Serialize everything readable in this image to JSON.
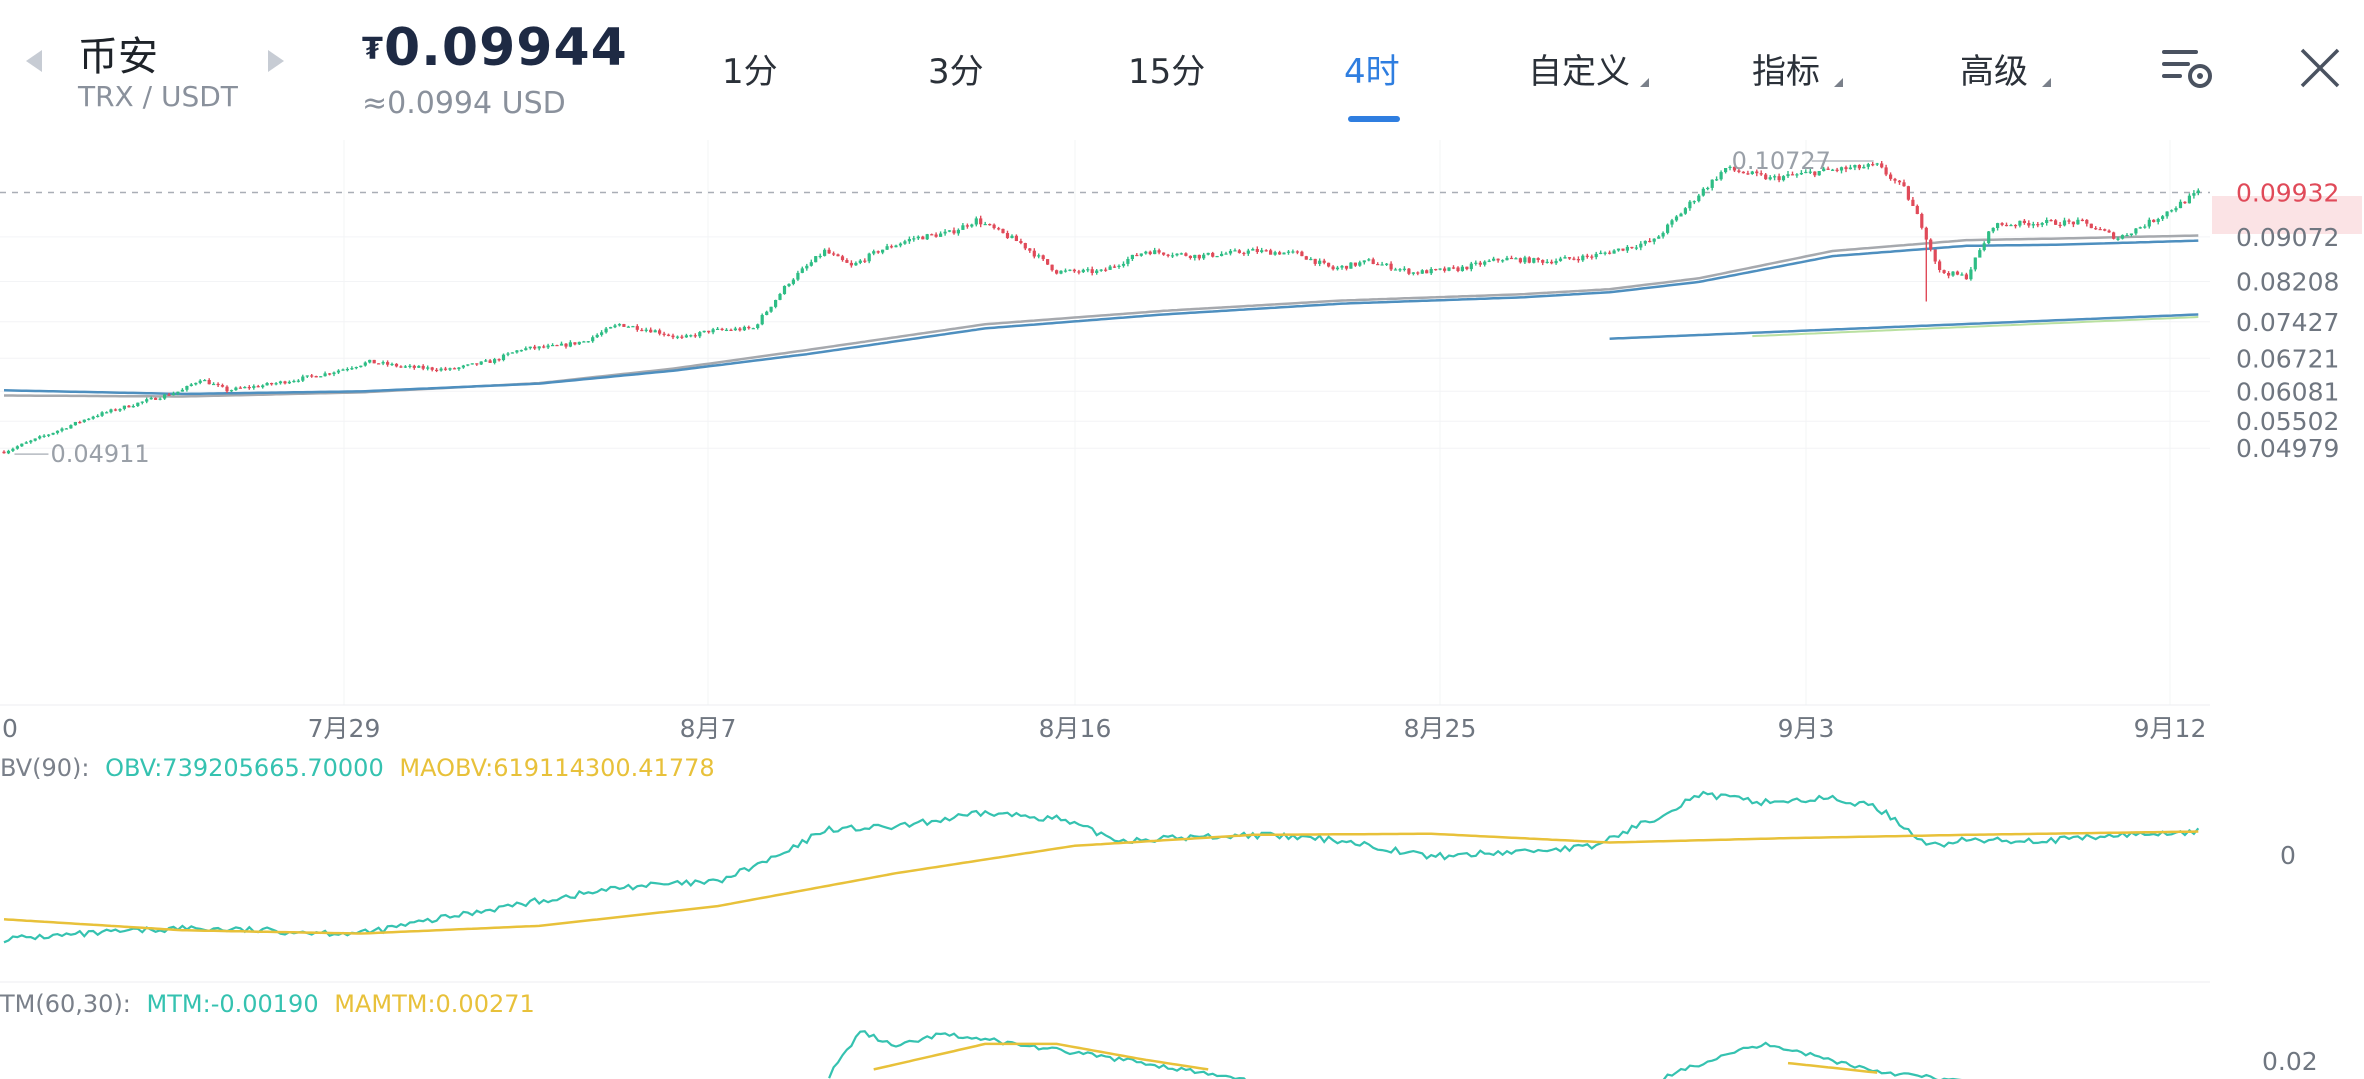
{
  "header": {
    "exchange": "币安",
    "pair": "TRX / USDT",
    "price_symbol": "₮",
    "price": "0.09944",
    "price_usd": "≈0.0994 USD",
    "tabs": [
      {
        "label": "1分",
        "active": false
      },
      {
        "label": "3分",
        "active": false
      },
      {
        "label": "15分",
        "active": false
      },
      {
        "label": "4时",
        "active": true
      },
      {
        "label": "自定义",
        "active": false,
        "dropdown": true
      },
      {
        "label": "指标",
        "active": false,
        "dropdown": true
      },
      {
        "label": "高级",
        "active": false,
        "dropdown": true
      }
    ],
    "icons": [
      "chart-settings-icon",
      "close-icon"
    ],
    "colors": {
      "accent": "#2f7ee0",
      "up": "#2ebd85",
      "down": "#e04a59"
    }
  },
  "chart_data": [
    {
      "type": "candlestick",
      "title": "TRX / USDT 4时",
      "x_tick_labels": [
        "0",
        "7月29",
        "8月7",
        "8月16",
        "8月25",
        "9月3",
        "9月12"
      ],
      "y_tick_labels": [
        "0.09932",
        "0.09072",
        "0.08208",
        "0.07427",
        "0.06721",
        "0.06081",
        "0.05502",
        "0.04979"
      ],
      "current_price": 0.09932,
      "max_label": "0.10727",
      "min_label": "0.04911",
      "ylim": [
        0.0475,
        0.1095
      ],
      "anchors_close": [
        [
          0,
          0.0491
        ],
        [
          10,
          0.0525
        ],
        [
          20,
          0.056
        ],
        [
          32,
          0.059
        ],
        [
          40,
          0.061
        ],
        [
          44,
          0.0632
        ],
        [
          50,
          0.061
        ],
        [
          60,
          0.0622
        ],
        [
          72,
          0.0642
        ],
        [
          82,
          0.0665
        ],
        [
          90,
          0.0655
        ],
        [
          100,
          0.065
        ],
        [
          110,
          0.0668
        ],
        [
          116,
          0.069
        ],
        [
          124,
          0.0695
        ],
        [
          130,
          0.0705
        ],
        [
          138,
          0.0738
        ],
        [
          146,
          0.0725
        ],
        [
          152,
          0.071
        ],
        [
          158,
          0.0725
        ],
        [
          168,
          0.073
        ],
        [
          176,
          0.082
        ],
        [
          184,
          0.088
        ],
        [
          190,
          0.085
        ],
        [
          196,
          0.088
        ],
        [
          204,
          0.0905
        ],
        [
          212,
          0.0915
        ],
        [
          218,
          0.094
        ],
        [
          228,
          0.0895
        ],
        [
          236,
          0.084
        ],
        [
          246,
          0.084
        ],
        [
          256,
          0.088
        ],
        [
          268,
          0.087
        ],
        [
          280,
          0.088
        ],
        [
          290,
          0.0875
        ],
        [
          298,
          0.0845
        ],
        [
          306,
          0.086
        ],
        [
          316,
          0.0838
        ],
        [
          326,
          0.0845
        ],
        [
          336,
          0.0865
        ],
        [
          346,
          0.086
        ],
        [
          356,
          0.087
        ],
        [
          370,
          0.09
        ],
        [
          380,
          0.099
        ],
        [
          386,
          0.104
        ],
        [
          396,
          0.102
        ],
        [
          408,
          0.1035
        ],
        [
          420,
          0.1045
        ],
        [
          426,
          0.1
        ],
        [
          430,
          0.093
        ],
        [
          434,
          0.084
        ],
        [
          440,
          0.083
        ],
        [
          446,
          0.093
        ],
        [
          456,
          0.0935
        ],
        [
          466,
          0.0935
        ],
        [
          474,
          0.0905
        ],
        [
          482,
          0.094
        ],
        [
          492,
          0.0993
        ]
      ],
      "spikes": [
        {
          "index": 431,
          "low": 0.0782
        }
      ],
      "ma_anchors": [
        [
          0,
          0.061
        ],
        [
          40,
          0.0603
        ],
        [
          80,
          0.0608
        ],
        [
          120,
          0.0623
        ],
        [
          150,
          0.0648
        ],
        [
          180,
          0.068
        ],
        [
          220,
          0.073
        ],
        [
          260,
          0.0757
        ],
        [
          300,
          0.0778
        ],
        [
          340,
          0.079
        ],
        [
          360,
          0.08
        ],
        [
          380,
          0.082
        ],
        [
          410,
          0.087
        ],
        [
          440,
          0.089
        ],
        [
          460,
          0.0892
        ],
        [
          492,
          0.09
        ]
      ],
      "ma2_anchors": [
        [
          0,
          0.06
        ],
        [
          40,
          0.0598
        ],
        [
          80,
          0.0606
        ],
        [
          120,
          0.0624
        ],
        [
          150,
          0.0652
        ],
        [
          180,
          0.0688
        ],
        [
          220,
          0.0738
        ],
        [
          260,
          0.0764
        ],
        [
          300,
          0.0784
        ],
        [
          340,
          0.0796
        ],
        [
          360,
          0.0806
        ],
        [
          380,
          0.0827
        ],
        [
          410,
          0.088
        ],
        [
          440,
          0.0901
        ],
        [
          460,
          0.0904
        ],
        [
          492,
          0.091
        ]
      ],
      "ma3_anchors": [
        [
          360,
          0.071
        ],
        [
          492,
          0.0757
        ]
      ],
      "ma4_anchors": [
        [
          392,
          0.0715
        ],
        [
          492,
          0.0752
        ]
      ]
    },
    {
      "type": "line",
      "label_prefix": "BV(90):",
      "obv_label": "OBV:739205665.70000",
      "maobv_label": "MAOBV:619114300.41778",
      "zero_label": "0",
      "obv_anchors": [
        [
          0,
          -0.9
        ],
        [
          40,
          -0.8
        ],
        [
          80,
          -0.85
        ],
        [
          110,
          -0.62
        ],
        [
          140,
          -0.42
        ],
        [
          160,
          -0.38
        ],
        [
          176,
          -0.1
        ],
        [
          184,
          0.1
        ],
        [
          200,
          0.12
        ],
        [
          220,
          0.25
        ],
        [
          236,
          0.2
        ],
        [
          250,
          0.0
        ],
        [
          280,
          0.05
        ],
        [
          300,
          0.0
        ],
        [
          320,
          -0.15
        ],
        [
          340,
          -0.1
        ],
        [
          356,
          -0.06
        ],
        [
          370,
          0.2
        ],
        [
          380,
          0.42
        ],
        [
          394,
          0.35
        ],
        [
          410,
          0.38
        ],
        [
          420,
          0.3
        ],
        [
          432,
          -0.05
        ],
        [
          440,
          0.0
        ],
        [
          460,
          0.0
        ],
        [
          476,
          0.05
        ],
        [
          492,
          0.08
        ]
      ],
      "maobv_anchors": [
        [
          0,
          -0.72
        ],
        [
          40,
          -0.82
        ],
        [
          80,
          -0.85
        ],
        [
          120,
          -0.78
        ],
        [
          160,
          -0.6
        ],
        [
          200,
          -0.3
        ],
        [
          240,
          -0.05
        ],
        [
          280,
          0.05
        ],
        [
          320,
          0.06
        ],
        [
          360,
          -0.02
        ],
        [
          400,
          0.02
        ],
        [
          440,
          0.05
        ],
        [
          492,
          0.08
        ]
      ],
      "ylim": [
        -1.0,
        0.55
      ]
    },
    {
      "type": "line",
      "label_prefix": "TM(60,30):",
      "mtm_label": "MTM:-0.00190",
      "mamtm_label": "MAMTM:0.00271",
      "tick_label": "0.02",
      "mtm_anchors": [
        [
          185,
          0.0
        ],
        [
          192,
          0.028
        ],
        [
          200,
          0.018
        ],
        [
          210,
          0.026
        ],
        [
          222,
          0.022
        ],
        [
          236,
          0.016
        ],
        [
          256,
          0.008
        ],
        [
          280,
          -0.004
        ],
        [
          370,
          -0.004
        ],
        [
          386,
          0.014
        ],
        [
          396,
          0.02
        ],
        [
          408,
          0.011
        ],
        [
          420,
          0.003
        ],
        [
          440,
          -0.004
        ]
      ],
      "mamtm_anchors": [
        [
          195,
          0.004
        ],
        [
          220,
          0.02
        ],
        [
          236,
          0.02
        ],
        [
          256,
          0.01
        ],
        [
          270,
          0.004
        ],
        [
          400,
          0.008
        ],
        [
          420,
          0.002
        ]
      ],
      "ylim": [
        -0.002,
        0.035
      ]
    }
  ]
}
